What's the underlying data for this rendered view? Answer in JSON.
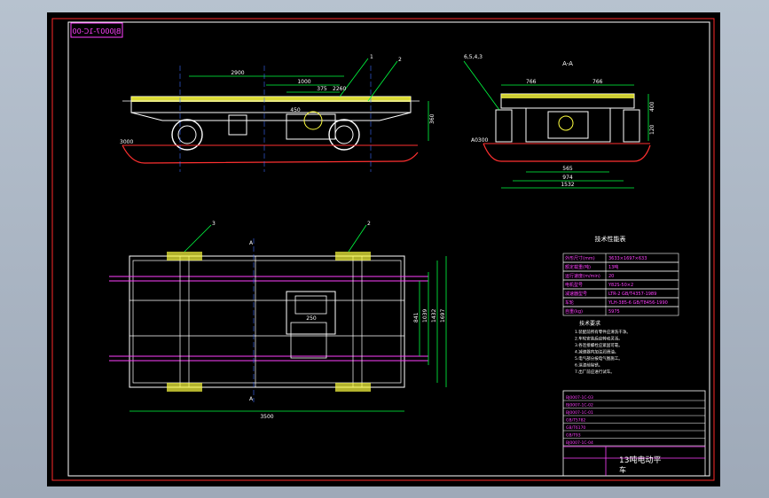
{
  "title_block": {
    "drawing_code": "BJ0007-1C-00",
    "title_line1": "13吨电动平",
    "title_line2": "车",
    "part_rows": [
      "BJ0007-1C-03",
      "BJ0007-1C-02",
      "BJ0007-1C-01",
      "GB/T5782",
      "GB/T6170",
      "GB/T93",
      "BJ0007-1C-04"
    ]
  },
  "views": {
    "section_label": "A-A",
    "section_mark_top": "A",
    "section_mark_bottom": "A"
  },
  "callouts": {
    "balloon_1": "1",
    "balloon_2": "2",
    "balloon_3": "3",
    "balloon_4": "2",
    "side_balloons": "6,5,4,3"
  },
  "dimensions": {
    "front_overall": "2900",
    "front_sub1": "1000",
    "front_sub2": "375",
    "front_sub3": "2260",
    "front_sub4": "450",
    "front_height": "360",
    "ground_label": "3000",
    "side_top_left": "766",
    "side_top_right": "766",
    "side_height": "400",
    "side_h2": "120",
    "side_ground": "A0300",
    "side_w1": "565",
    "side_w2": "974",
    "side_w3": "1532",
    "plan_length": "3500",
    "plan_h1": "841",
    "plan_h2": "1039",
    "plan_h3": "1432",
    "plan_h4": "1697",
    "plan_inner": "250"
  },
  "spec_table": {
    "heading": "技术性能表",
    "rows": [
      {
        "label": "外形尺寸(mm)",
        "value": "3633×1697×633"
      },
      {
        "label": "额定载重(吨)",
        "value": "13吨"
      },
      {
        "label": "运行速度(m/min)",
        "value": "20"
      },
      {
        "label": "电机型号",
        "value": "Y82S-50×2"
      },
      {
        "label": "减速器型号",
        "value": "LTR-2 GB/T4357-1989"
      },
      {
        "label": "车轮",
        "value": "YLH-385-6 GB/T8456-1990"
      },
      {
        "label": "自重(kg)",
        "value": "5975"
      }
    ]
  },
  "notes": {
    "heading": "技术要求",
    "lines": [
      "1.装配前所有零件应清洗干净。",
      "2.车轮安装后应转动灵活。",
      "3.各连接螺栓应紧固可靠。",
      "4.减速器内加注润滑油。",
      "5.电气部分按电气图施工。",
      "6.涂漆前除锈。",
      "7.出厂前应进行试车。"
    ]
  },
  "colors": {
    "sheet": "#000000",
    "border": "#ff2a2a",
    "geometry": "#ffffff",
    "dimension": "#00ff40",
    "accent": "#ff40ff",
    "rail": "#ff40ff",
    "ground": "#ff3030",
    "axis": "#3a6bff",
    "yellow": "#ffff40"
  }
}
